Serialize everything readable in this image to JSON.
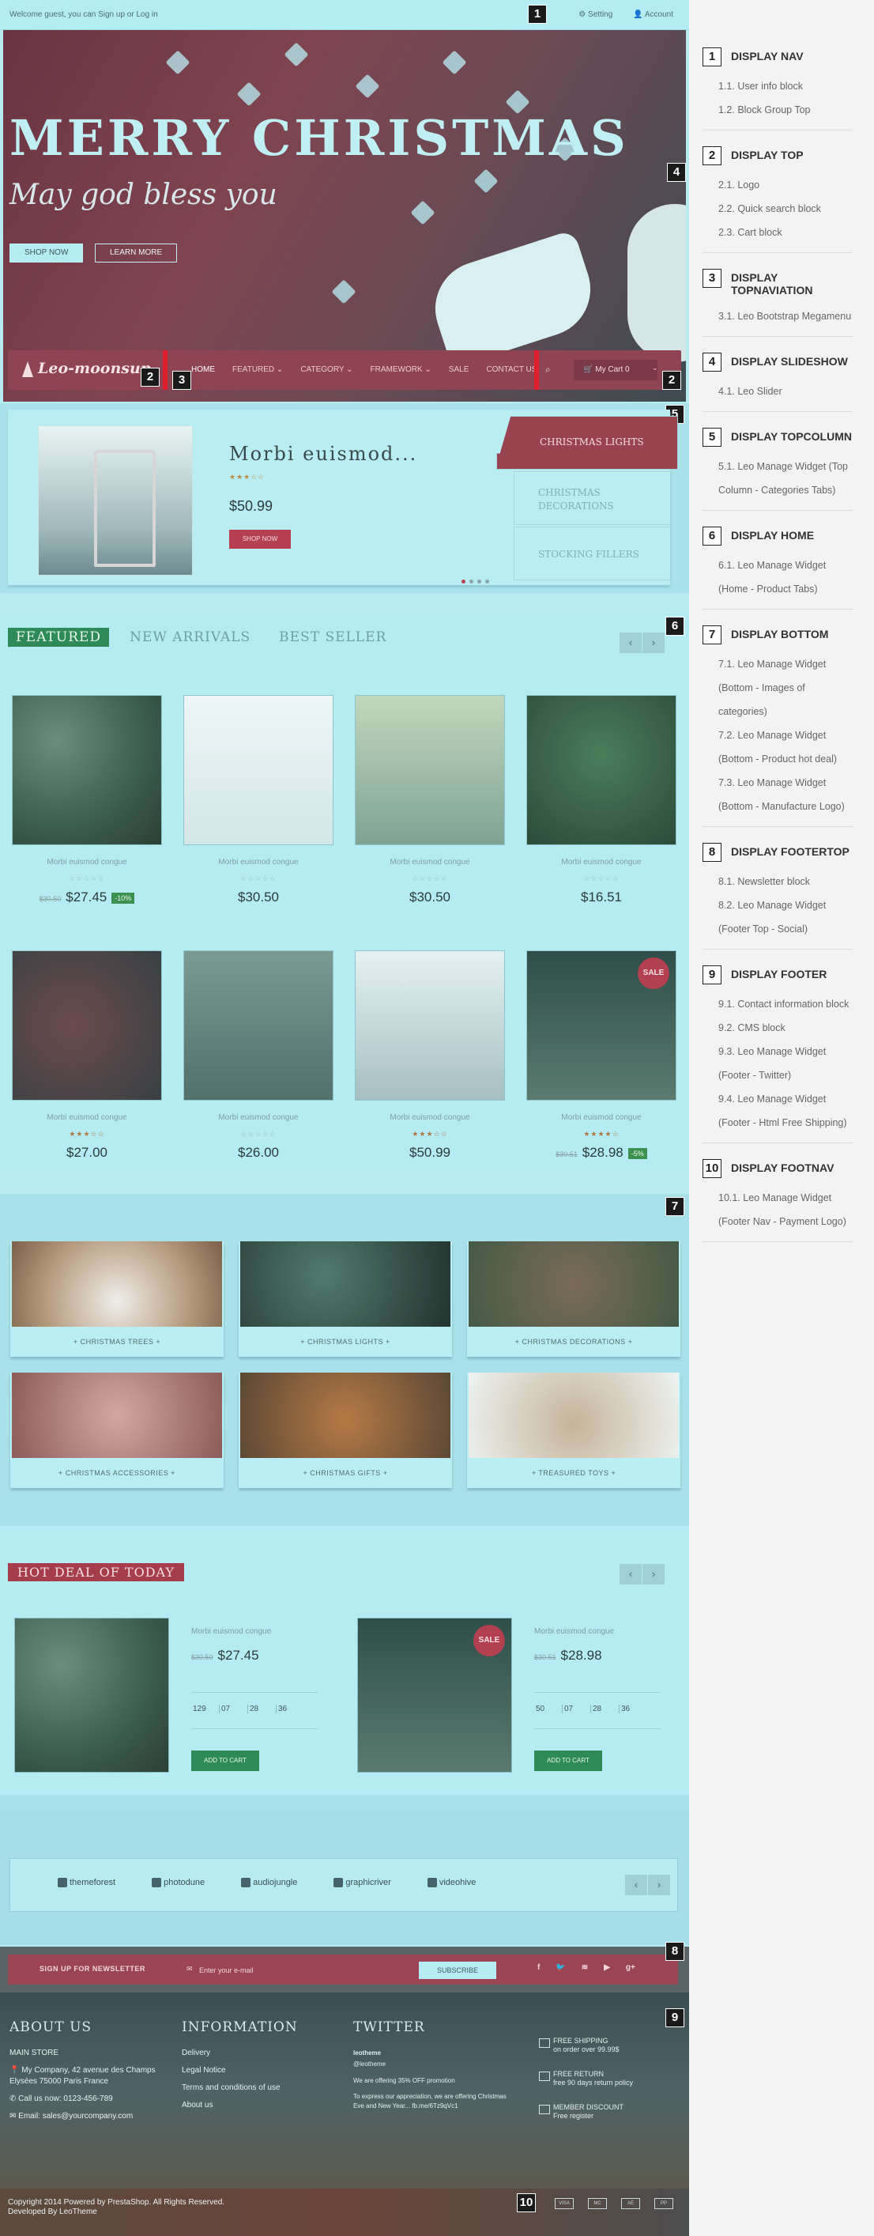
{
  "nav": {
    "welcome": "Welcome guest, you can Sign up or Log in",
    "setting": "Setting",
    "account": "Account",
    "marker": "1"
  },
  "slider": {
    "title": "MERRY CHRISTMAS",
    "subtitle": "May god bless you",
    "shop_now": "SHOP NOW",
    "learn_more": "LEARN MORE",
    "marker": "4"
  },
  "header": {
    "logo": "Leo-moonsun",
    "menu": [
      "HOME",
      "FEATURED",
      "CATEGORY",
      "FRAMEWORK",
      "SALE",
      "CONTACT US"
    ],
    "cart": "My Cart 0",
    "marker_logo": "2",
    "marker_menu": "3",
    "marker_cart": "2"
  },
  "topcolumn": {
    "product_title": "Morbi euismod...",
    "stars": "★★★☆☆",
    "price": "$50.99",
    "shop_now": "SHOP NOW",
    "tabs": [
      "CHRISTMAS LIGHTS",
      "CHRISTMAS DECORATIONS",
      "STOCKING FILLERS"
    ],
    "marker": "5"
  },
  "home": {
    "tabs": [
      "FEATURED",
      "NEW ARRIVALS",
      "BEST SELLER"
    ],
    "marker": "6",
    "products": [
      {
        "name": "Morbi euismod congue",
        "stars": "☆☆☆☆☆",
        "old": "$30.50",
        "price": "$27.45",
        "discount": "-10%",
        "sale": ""
      },
      {
        "name": "Morbi euismod congue",
        "stars": "☆☆☆☆☆",
        "old": "",
        "price": "$30.50",
        "discount": "",
        "sale": ""
      },
      {
        "name": "Morbi euismod congue",
        "stars": "☆☆☆☆☆",
        "old": "",
        "price": "$30.50",
        "discount": "",
        "sale": ""
      },
      {
        "name": "Morbi euismod congue",
        "stars": "☆☆☆☆☆",
        "old": "",
        "price": "$16.51",
        "discount": "",
        "sale": ""
      },
      {
        "name": "Morbi euismod congue",
        "stars": "★★★☆☆",
        "old": "",
        "price": "$27.00",
        "discount": "",
        "sale": ""
      },
      {
        "name": "Morbi euismod congue",
        "stars": "☆☆☆☆☆",
        "old": "",
        "price": "$26.00",
        "discount": "",
        "sale": ""
      },
      {
        "name": "Morbi euismod congue",
        "stars": "★★★☆☆",
        "old": "",
        "price": "$50.99",
        "discount": "",
        "sale": ""
      },
      {
        "name": "Morbi euismod congue",
        "stars": "★★★★☆",
        "old": "$30.51",
        "price": "$28.98",
        "discount": "-5%",
        "sale": "SALE"
      }
    ]
  },
  "bottom": {
    "marker": "7",
    "categories": [
      "+ CHRISTMAS TREES +",
      "+ CHRISTMAS LIGHTS +",
      "+ CHRISTMAS DECORATIONS +",
      "+ CHRISTMAS ACCESSORIES +",
      "+ CHRISTMAS GIFTS +",
      "+ TREASURED TOYS +"
    ],
    "hotdeal_title": "HOT DEAL OF TODAY",
    "deals": [
      {
        "name": "Morbi euismod congue",
        "old": "$30.50",
        "price": "$27.45",
        "timer": [
          "129",
          "07",
          "28",
          "36"
        ],
        "button": "ADD TO CART",
        "sale": ""
      },
      {
        "name": "Morbi euismod congue",
        "old": "$30.51",
        "price": "$28.98",
        "timer": [
          "50",
          "07",
          "28",
          "36"
        ],
        "button": "ADD TO CART",
        "sale": "SALE"
      }
    ],
    "manufacturers": [
      "themeforest",
      "photodune",
      "audiojungle",
      "graphicriver",
      "videohive"
    ]
  },
  "footertop": {
    "label": "SIGN UP FOR NEWSLETTER",
    "placeholder": "Enter your e-mail",
    "subscribe": "SUBSCRIBE",
    "social": [
      "f",
      "t",
      "rss",
      "yt",
      "g+"
    ],
    "marker": "8"
  },
  "footer": {
    "marker": "9",
    "about_title": "ABOUT US",
    "store": "MAIN STORE",
    "address": "My Company, 42 avenue des Champs Elysées 75000 Paris France",
    "call": "Call us now: 0123-456-789",
    "email": "Email: sales@yourcompany.com",
    "info_title": "INFORMATION",
    "info_links": [
      "Delivery",
      "Legal Notice",
      "Terms and conditions of use",
      "About us"
    ],
    "twitter_title": "TWITTER",
    "tw_name": "leotheme",
    "tw_handle": "@leotheme",
    "tw_line1": "We are offering 35% OFF promotion",
    "tw_line2": "To express our appreciation, we are offering Christmas Eve and New Year... fb.me/6Tz9qVc1",
    "shipping": [
      {
        "title": "FREE SHIPPING",
        "text": "on order over 99.99$"
      },
      {
        "title": "FREE RETURN",
        "text": "free 90 days return policy"
      },
      {
        "title": "MEMBER DISCOUNT",
        "text": "Free register"
      }
    ]
  },
  "footnav": {
    "copyright": "Copyright 2014 Powered by PrestaShop. All Rights Reserved.",
    "developed": "Developed By LeoTheme",
    "marker": "10",
    "payments": [
      "VISA",
      "MC",
      "AE",
      "PP"
    ]
  },
  "sidebar": [
    {
      "num": "1",
      "title": "DISPLAY NAV",
      "items": [
        "1.1. User info block",
        "1.2. Block Group Top"
      ]
    },
    {
      "num": "2",
      "title": "DISPLAY TOP",
      "items": [
        "2.1. Logo",
        "2.2. Quick search block",
        "2.3. Cart block"
      ]
    },
    {
      "num": "3",
      "title": "DISPLAY TOPNAVIATION",
      "items": [
        "3.1. Leo Bootstrap Megamenu"
      ]
    },
    {
      "num": "4",
      "title": "DISPLAY SLIDESHOW",
      "items": [
        "4.1. Leo Slider"
      ]
    },
    {
      "num": "5",
      "title": "DISPLAY TOPCOLUMN",
      "items": [
        "5.1. Leo Manage Widget (Top Column - Categories Tabs)"
      ]
    },
    {
      "num": "6",
      "title": "DISPLAY HOME",
      "items": [
        "6.1. Leo Manage Widget (Home - Product Tabs)"
      ]
    },
    {
      "num": "7",
      "title": "DISPLAY BOTTOM",
      "items": [
        "7.1. Leo Manage Widget (Bottom - Images of categories)",
        "7.2. Leo Manage Widget (Bottom - Product hot deal)",
        "7.3. Leo Manage Widget (Bottom - Manufacture Logo)"
      ]
    },
    {
      "num": "8",
      "title": "DISPLAY FOOTERTOP",
      "items": [
        "8.1. Newsletter block",
        "8.2. Leo Manage Widget (Footer Top - Social)"
      ]
    },
    {
      "num": "9",
      "title": "DISPLAY FOOTER",
      "items": [
        "9.1. Contact information block",
        "9.2. CMS block",
        "9.3. Leo Manage Widget (Footer - Twitter)",
        "9.4. Leo Manage Widget (Footer - Html Free Shipping)"
      ]
    },
    {
      "num": "10",
      "title": "DISPLAY FOOTNAV",
      "items": [
        "10.1. Leo Manage Widget (Footer Nav - Payment Logo)"
      ]
    }
  ]
}
